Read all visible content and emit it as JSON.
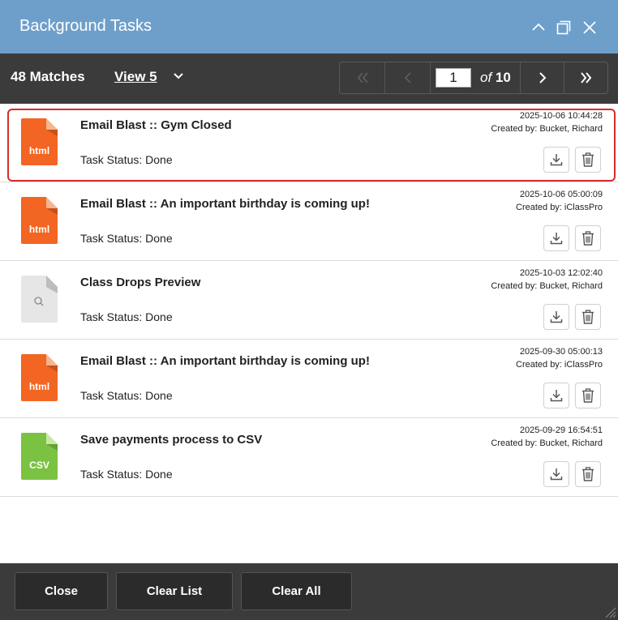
{
  "window": {
    "title": "Background Tasks",
    "controls": [
      "collapse-icon",
      "maximize-icon",
      "close-icon"
    ]
  },
  "toolbar": {
    "matches": "48 Matches",
    "view": "View 5",
    "pager": {
      "current_page": "1",
      "of_label": "of",
      "total_pages": "10"
    }
  },
  "tasks": [
    {
      "title": "Email Blast :: Gym Closed",
      "status": "Task Status: Done",
      "date": "2025-10-06 10:44:28",
      "creator": "Created by: Bucket, Richard",
      "file_type": "html",
      "icon_label": "html",
      "selected": true
    },
    {
      "title": "Email Blast :: An important birthday is coming up!",
      "status": "Task Status: Done",
      "date": "2025-10-06 05:00:09",
      "creator": "Created by: iClassPro",
      "file_type": "html",
      "icon_label": "html",
      "selected": false
    },
    {
      "title": "Class Drops Preview",
      "status": "Task Status: Done",
      "date": "2025-10-03 12:02:40",
      "creator": "Created by: Bucket, Richard",
      "file_type": "preview",
      "icon_label": "",
      "selected": false
    },
    {
      "title": "Email Blast :: An important birthday is coming up!",
      "status": "Task Status: Done",
      "date": "2025-09-30 05:00:13",
      "creator": "Created by: iClassPro",
      "file_type": "html",
      "icon_label": "html",
      "selected": false
    },
    {
      "title": "Save payments process to CSV",
      "status": "Task Status: Done",
      "date": "2025-09-29 16:54:51",
      "creator": "Created by: Bucket, Richard",
      "file_type": "csv",
      "icon_label": "CSV",
      "selected": false
    }
  ],
  "footer": {
    "close_label": "Close",
    "clear_list_label": "Clear List",
    "clear_all_label": "Clear All"
  },
  "colors": {
    "titlebar": "#6e9fcb",
    "toolbar": "#3b3b3b",
    "html_icon": "#f26522",
    "csv_icon": "#7cc242",
    "preview_icon": "#e6e6e6",
    "selected_outline": "#d92b2b"
  }
}
